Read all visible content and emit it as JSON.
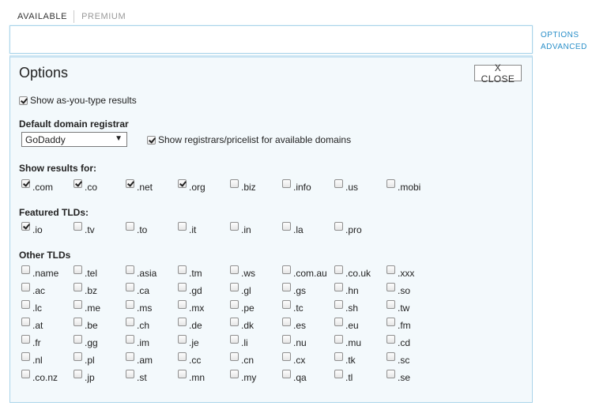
{
  "tabs": [
    {
      "label": "AVAILABLE",
      "active": true
    },
    {
      "label": "PREMIUM",
      "active": false
    }
  ],
  "search": {
    "value": "",
    "placeholder": ""
  },
  "side_links": {
    "options": "OPTIONS",
    "advanced": "ADVANCED"
  },
  "panel": {
    "title": "Options",
    "close_label": "X CLOSE",
    "as_you_type": {
      "label": "Show as-you-type results",
      "checked": true
    },
    "registrar": {
      "heading": "Default domain registrar",
      "selected": "GoDaddy",
      "show_pricelist": {
        "label": "Show registrars/pricelist for available domains",
        "checked": true
      }
    },
    "show_results": {
      "heading": "Show results for:",
      "tlds": [
        {
          "label": ".com",
          "checked": true
        },
        {
          "label": ".co",
          "checked": true
        },
        {
          "label": ".net",
          "checked": true
        },
        {
          "label": ".org",
          "checked": true
        },
        {
          "label": ".biz",
          "checked": false
        },
        {
          "label": ".info",
          "checked": false
        },
        {
          "label": ".us",
          "checked": false
        },
        {
          "label": ".mobi",
          "checked": false
        }
      ]
    },
    "featured": {
      "heading": "Featured TLDs:",
      "tlds": [
        {
          "label": ".io",
          "checked": true
        },
        {
          "label": ".tv",
          "checked": false
        },
        {
          "label": ".to",
          "checked": false
        },
        {
          "label": ".it",
          "checked": false
        },
        {
          "label": ".in",
          "checked": false
        },
        {
          "label": ".la",
          "checked": false
        },
        {
          "label": ".pro",
          "checked": false
        }
      ]
    },
    "other": {
      "heading": "Other TLDs",
      "rows": [
        [
          ".name",
          ".tel",
          ".asia",
          ".tm",
          ".ws",
          ".com.au",
          ".co.uk",
          ".xxx"
        ],
        [
          ".ac",
          ".bz",
          ".ca",
          ".gd",
          ".gl",
          ".gs",
          ".hn",
          ".so"
        ],
        [
          ".lc",
          ".me",
          ".ms",
          ".mx",
          ".pe",
          ".tc",
          ".sh",
          ".tw"
        ],
        [
          ".at",
          ".be",
          ".ch",
          ".de",
          ".dk",
          ".es",
          ".eu",
          ".fm"
        ],
        [
          ".fr",
          ".gg",
          ".im",
          ".je",
          ".li",
          ".nu",
          ".mu",
          ".cd"
        ],
        [
          ".nl",
          ".pl",
          ".am",
          ".cc",
          ".cn",
          ".cx",
          ".tk",
          ".sc"
        ],
        [
          ".co.nz",
          ".jp",
          ".st",
          ".mn",
          ".my",
          ".qa",
          ".tl",
          ".se"
        ]
      ]
    }
  }
}
